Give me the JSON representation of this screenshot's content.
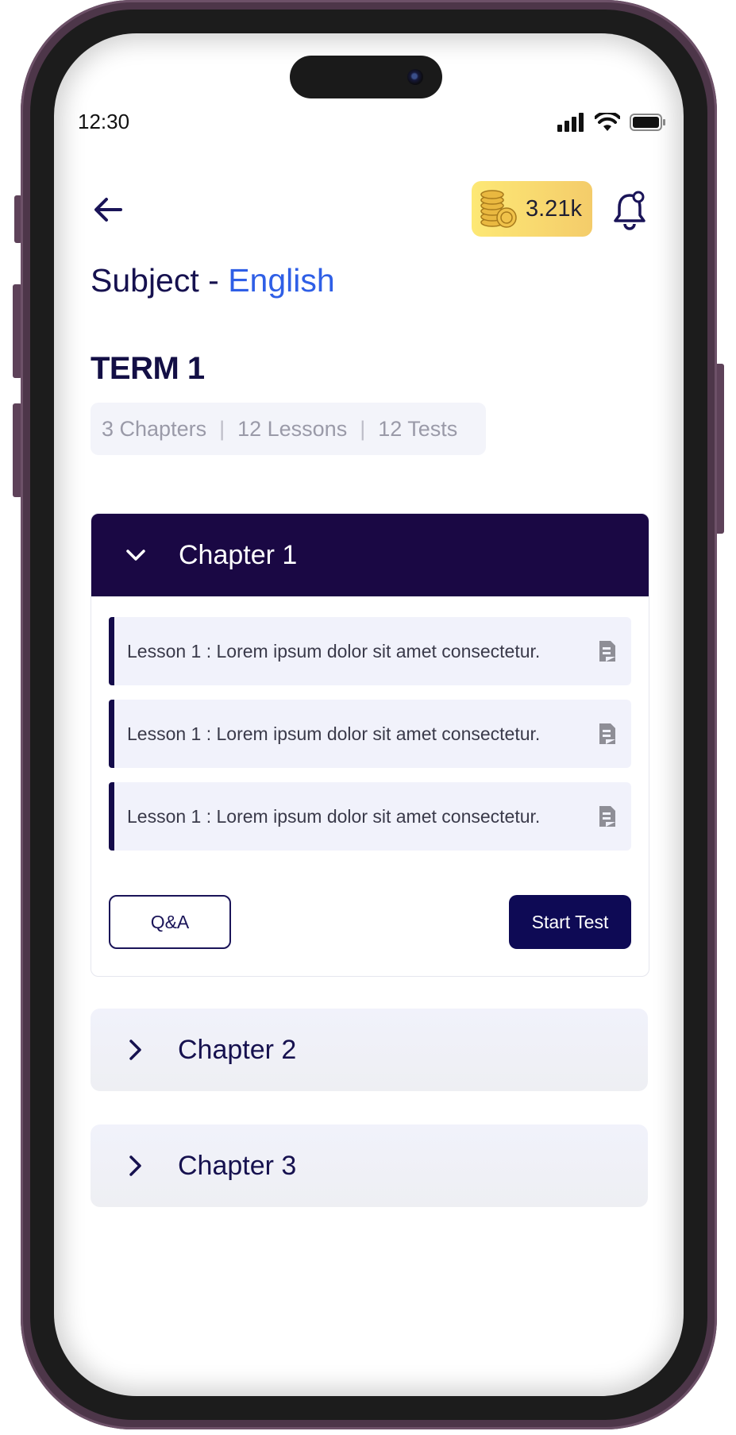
{
  "status_bar": {
    "time": "12:30"
  },
  "header": {
    "coins_value": "3.21k",
    "subject_prefix": "Subject - ",
    "subject_name": "English"
  },
  "term": {
    "title": "TERM 1",
    "chapters_count": "3 Chapters",
    "lessons_count": "12 Lessons",
    "tests_count": "12 Tests",
    "separator": "|"
  },
  "chapters": [
    {
      "title": "Chapter 1",
      "expanded": true,
      "lessons": [
        "Lesson 1 : Lorem ipsum dolor sit amet consectetur.",
        "Lesson 1 : Lorem ipsum dolor sit amet consectetur.",
        "Lesson 1 : Lorem ipsum dolor sit amet consectetur."
      ],
      "qa_label": "Q&A",
      "start_test_label": "Start Test"
    },
    {
      "title": "Chapter 2",
      "expanded": false
    },
    {
      "title": "Chapter 3",
      "expanded": false
    }
  ],
  "icons": {
    "back": "arrow-left-icon",
    "coins": "coins-icon",
    "notifications": "bell-icon",
    "chevron_open": "chevron-down-icon",
    "chevron_closed": "chevron-right-icon",
    "lesson_doc": "document-icon"
  },
  "colors": {
    "primary_dark": "#1a0844",
    "accent_blue": "#2f5fe6",
    "coin_gradient_start": "#fde875",
    "coin_gradient_end": "#f4cc6a",
    "button_dark": "#0e0a55"
  }
}
